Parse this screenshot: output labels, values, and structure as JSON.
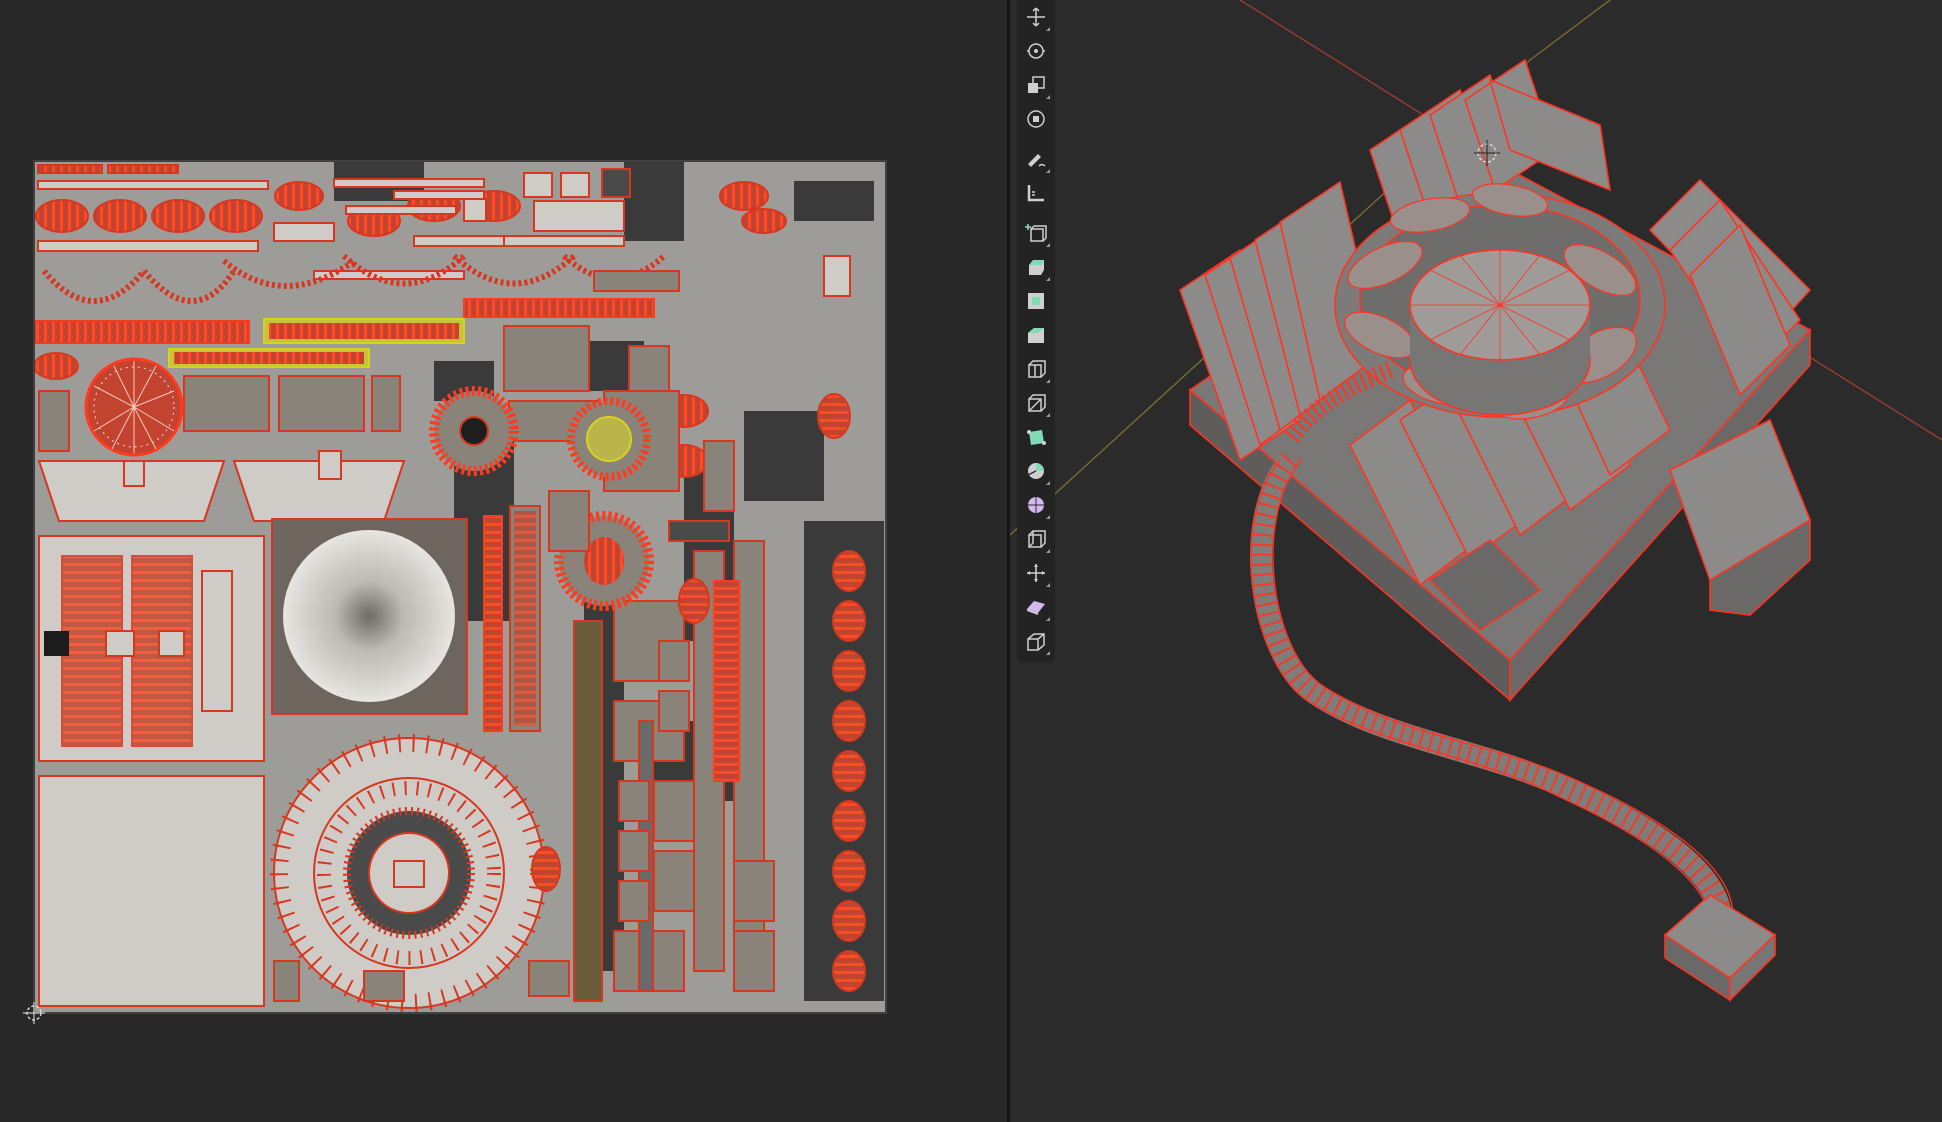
{
  "colors": {
    "background": "#282828",
    "uv_island_fill": "#c9c5c0",
    "uv_edge": "#e0321c",
    "uv_vertex": "#ff3b1f",
    "uv_selected": "#d8d21e",
    "mesh_fill": "#8d8b89",
    "mesh_edge": "#ff3322",
    "axis_x": "#b5473a",
    "axis_y": "#8a7a3a",
    "tool_icon": "#cfcfcf",
    "tool_icon_add": "#7fdcb4",
    "tool_icon_sphere": "#d5b7f0"
  },
  "uv_editor": {
    "cursor_icon": "uv-2d-cursor-icon"
  },
  "viewport": {
    "object": "cpu-cooler-mesh",
    "cursor_icon": "3d-cursor-icon"
  },
  "toolbar": {
    "tools": [
      {
        "id": "move",
        "icon": "move-icon"
      },
      {
        "id": "rotate",
        "icon": "rotate-icon"
      },
      {
        "id": "scale",
        "icon": "scale-icon"
      },
      {
        "id": "transform",
        "icon": "transform-icon"
      },
      {
        "id": "annotate",
        "icon": "annotate-icon"
      },
      {
        "id": "measure",
        "icon": "measure-icon"
      },
      {
        "id": "add-cube",
        "icon": "add-cube-icon"
      },
      {
        "id": "extrude",
        "icon": "extrude-region-icon"
      },
      {
        "id": "inset",
        "icon": "inset-faces-icon"
      },
      {
        "id": "bevel",
        "icon": "bevel-icon"
      },
      {
        "id": "loop-cut",
        "icon": "loop-cut-icon"
      },
      {
        "id": "knife",
        "icon": "knife-icon"
      },
      {
        "id": "poly-build",
        "icon": "poly-build-icon"
      },
      {
        "id": "spin",
        "icon": "spin-icon"
      },
      {
        "id": "smooth",
        "icon": "smooth-icon"
      },
      {
        "id": "edge-slide",
        "icon": "edge-slide-icon"
      },
      {
        "id": "shrink-fatten",
        "icon": "shrink-fatten-icon"
      },
      {
        "id": "shear",
        "icon": "shear-icon"
      },
      {
        "id": "rip-region",
        "icon": "rip-region-icon"
      }
    ]
  }
}
